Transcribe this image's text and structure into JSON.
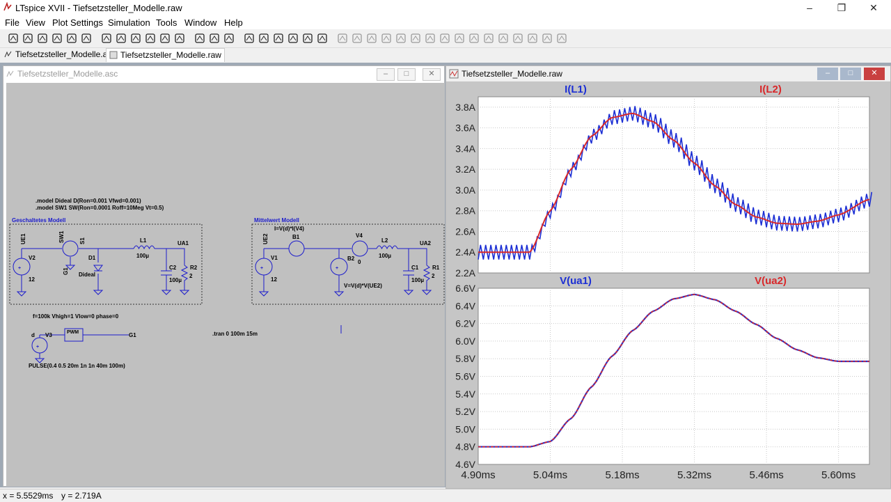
{
  "app": {
    "title": "LTspice XVII - Tiefsetzsteller_Modelle.raw"
  },
  "window_controls": [
    "minimize",
    "maximize",
    "close"
  ],
  "menu": [
    "File",
    "View",
    "Plot Settings",
    "Simulation",
    "Tools",
    "Window",
    "Help"
  ],
  "toolbar_icons": [
    "run-icon",
    "open-icon",
    "save-icon",
    "control-panel-icon",
    "halt-icon",
    "pan-icon",
    "zoom-in-icon",
    "zoom-area-icon",
    "zoom-out-icon",
    "zoom-fit-icon",
    "autorange-icon",
    "center-icon",
    "tile-horizontal-icon",
    "tile-vertical-icon",
    "cascade-icon",
    "cut-icon",
    "copy-icon",
    "paste-icon",
    "find-icon",
    "print-preview-icon",
    "print-icon",
    "wire-icon",
    "ground-icon",
    "label-icon",
    "resistor-icon",
    "capacitor-icon",
    "inductor-icon",
    "diode-icon",
    "component-icon",
    "move-icon",
    "drag-icon",
    "undo-icon",
    "redo-icon",
    "rotate-icon",
    "mirror-icon",
    "text-icon",
    "spice-directive-icon"
  ],
  "tabs": [
    {
      "label": "Tiefsetzsteller_Modelle.asc",
      "active": false
    },
    {
      "label": "Tiefsetzsteller_Modelle.raw",
      "active": true
    }
  ],
  "schematic": {
    "title": "Tiefsetzsteller_Modelle.asc",
    "model_line1": ".model Dideal D(Ron=0.001 Vfwd=0.001)",
    "model_line2": ".model SW1 SW(Ron=0.0001 Roff=10Meg Vt=0.5)",
    "box1_title": "Geschaltetes Modell",
    "box2_title": "Mittelwert Modell",
    "labels": {
      "ue1": "UE1",
      "v2": "V2",
      "v2_val": "12",
      "sw1": "SW1",
      "s1": "S1",
      "g1": "G1",
      "d1": "D1",
      "dideal": "Dideal",
      "l1": "L1",
      "l1_val": "100µ",
      "ua1": "UA1",
      "c2": "C2",
      "c2_val": "100µ",
      "r2": "R2",
      "r2_val": "2",
      "ue2": "UE2",
      "b1_expr": "I=V(d)*I(V4)",
      "b1": "B1",
      "v1": "V1",
      "v1_val": "12",
      "v4": "V4",
      "v4_val": "0",
      "l2": "L2",
      "l2_val": "100µ",
      "ua2": "UA2",
      "b2": "B2",
      "b2_expr": "V=V(d)*V(UE2)",
      "c1": "C1",
      "c1_val": "100µ",
      "r1": "R1",
      "r1_val": "2",
      "pulse_params": "f=100k Vhigh=1 Vlow=0 phase=0",
      "d_label": "d",
      "v3": "V3",
      "pwm": "PWM",
      "g1_out": "G1",
      "pulse": "PULSE(0.4 0.5 20m 1n 1n 40m 100m)",
      "tran": ".tran 0 100m 15m"
    }
  },
  "plot": {
    "title": "Tiefsetzsteller_Modelle.raw",
    "colors": {
      "trace1": "#1c2fd4",
      "trace2": "#d8282a",
      "background": "#ffffff",
      "grid": "#c8c8c8"
    },
    "x_ticks": [
      "4.90ms",
      "5.04ms",
      "5.18ms",
      "5.32ms",
      "5.46ms",
      "5.60ms"
    ]
  },
  "chart_data": [
    {
      "type": "line",
      "title": "",
      "xlabel": "",
      "ylabel": "",
      "xlim": [
        4.9,
        5.66
      ],
      "ylim": [
        2.2,
        3.9
      ],
      "y_ticks": [
        "3.8A",
        "3.6A",
        "3.4A",
        "3.2A",
        "3.0A",
        "2.8A",
        "2.6A",
        "2.4A",
        "2.2A"
      ],
      "x": [
        4.9,
        4.97,
        5.0,
        5.04,
        5.08,
        5.12,
        5.16,
        5.2,
        5.24,
        5.28,
        5.32,
        5.36,
        5.4,
        5.44,
        5.48,
        5.52,
        5.56,
        5.6,
        5.66
      ],
      "series": [
        {
          "name": "I(L1)",
          "values": [
            2.4,
            2.4,
            2.4,
            2.8,
            3.2,
            3.52,
            3.7,
            3.74,
            3.66,
            3.48,
            3.26,
            3.04,
            2.86,
            2.74,
            2.68,
            2.67,
            2.7,
            2.76,
            2.91
          ],
          "ripple": 0.14
        },
        {
          "name": "I(L2)",
          "values": [
            2.4,
            2.4,
            2.4,
            2.8,
            3.2,
            3.52,
            3.7,
            3.74,
            3.66,
            3.48,
            3.26,
            3.04,
            2.86,
            2.74,
            2.68,
            2.67,
            2.7,
            2.76,
            2.91
          ]
        }
      ]
    },
    {
      "type": "line",
      "title": "",
      "xlabel": "",
      "ylabel": "",
      "xlim": [
        4.9,
        5.66
      ],
      "ylim": [
        4.6,
        6.6
      ],
      "y_ticks": [
        "6.6V",
        "6.4V",
        "6.2V",
        "6.0V",
        "5.8V",
        "5.6V",
        "5.4V",
        "5.2V",
        "5.0V",
        "4.8V",
        "4.6V"
      ],
      "x": [
        4.9,
        4.97,
        5.0,
        5.04,
        5.08,
        5.12,
        5.16,
        5.2,
        5.24,
        5.28,
        5.32,
        5.36,
        5.4,
        5.44,
        5.48,
        5.52,
        5.56,
        5.6,
        5.66
      ],
      "series": [
        {
          "name": "V(ua1)",
          "values": [
            4.8,
            4.8,
            4.8,
            4.86,
            5.12,
            5.48,
            5.83,
            6.12,
            6.34,
            6.48,
            6.53,
            6.47,
            6.34,
            6.19,
            6.03,
            5.9,
            5.81,
            5.77,
            5.77
          ]
        },
        {
          "name": "V(ua2)",
          "values": [
            4.8,
            4.8,
            4.8,
            4.86,
            5.12,
            5.48,
            5.83,
            6.12,
            6.34,
            6.48,
            6.53,
            6.47,
            6.34,
            6.19,
            6.03,
            5.9,
            5.81,
            5.77,
            5.77
          ]
        }
      ]
    }
  ],
  "status": {
    "x": "x = 5.5529ms",
    "y": "y = 2.719A"
  }
}
